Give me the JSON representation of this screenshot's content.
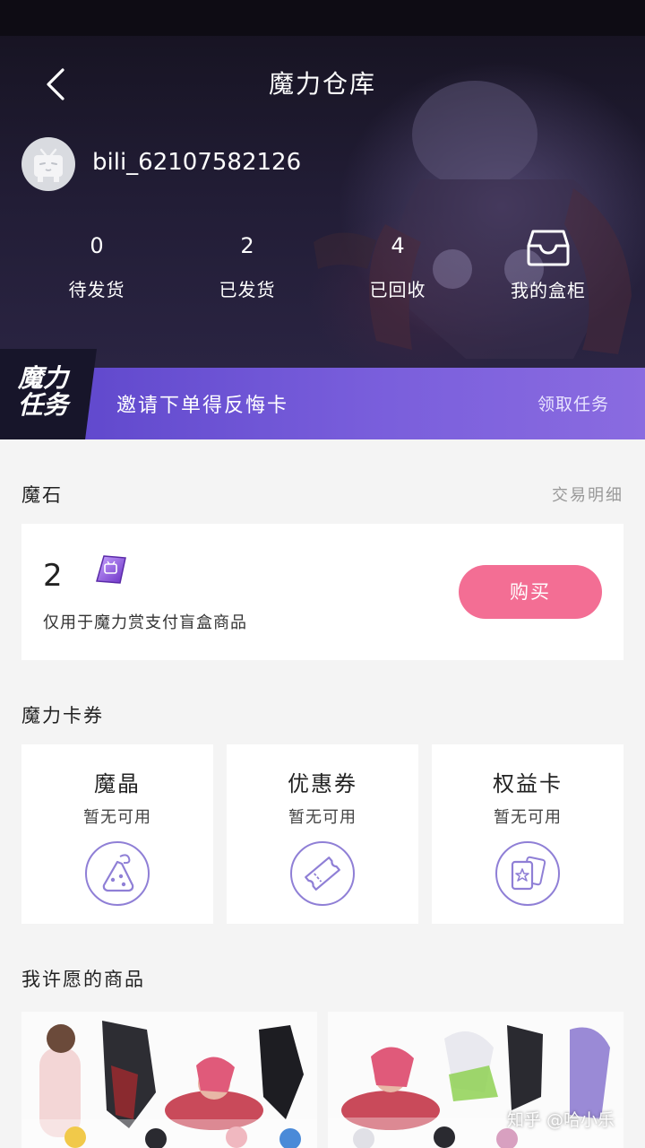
{
  "header": {
    "title": "魔力仓库",
    "username": "bili_62107582126"
  },
  "stats": [
    {
      "value": "0",
      "label": "待发货"
    },
    {
      "value": "2",
      "label": "已发货"
    },
    {
      "value": "4",
      "label": "已回收"
    }
  ],
  "cabinet": {
    "label": "我的盒柜"
  },
  "task": {
    "badge_line1": "魔力",
    "badge_line2": "任务",
    "text": "邀请下单得反悔卡",
    "action": "领取任务"
  },
  "magic_stone": {
    "title": "魔石",
    "link": "交易明细",
    "count": "2",
    "description": "仅用于魔力赏支付盲盒商品",
    "buy_label": "购买"
  },
  "cards_section": {
    "title": "魔力卡券",
    "items": [
      {
        "title": "魔晶",
        "status": "暂无可用",
        "icon": "crystal-bag-icon"
      },
      {
        "title": "优惠券",
        "status": "暂无可用",
        "icon": "ticket-icon"
      },
      {
        "title": "权益卡",
        "status": "暂无可用",
        "icon": "star-cards-icon"
      }
    ]
  },
  "wishlist": {
    "title": "我许愿的商品"
  },
  "watermark": "知乎 @哈小乐",
  "colors": {
    "accent_purple": "#6a51d6",
    "buy_pink": "#f36e94",
    "icon_purple": "#8f7fd6"
  }
}
